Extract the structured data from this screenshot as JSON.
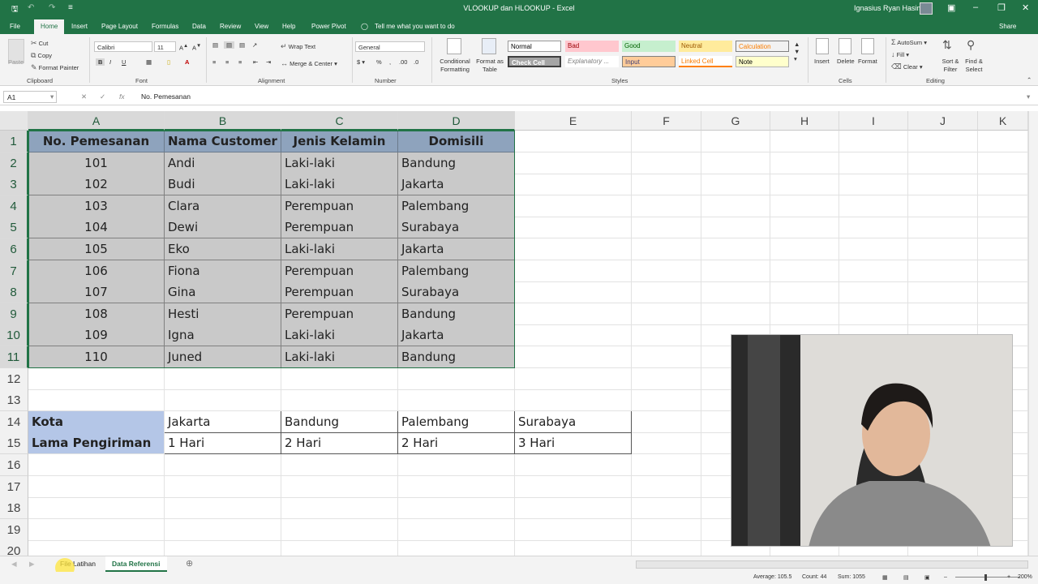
{
  "titlebar": {
    "title": "VLOOKUP dan HLOOKUP  -  Excel",
    "user": "Ignasius Ryan Hasim",
    "save_icon": "save-icon",
    "undo_icon": "undo-icon",
    "redo_icon": "redo-icon"
  },
  "tabs": [
    {
      "label": "File"
    },
    {
      "label": "Home"
    },
    {
      "label": "Insert"
    },
    {
      "label": "Page Layout"
    },
    {
      "label": "Formulas"
    },
    {
      "label": "Data"
    },
    {
      "label": "Review"
    },
    {
      "label": "View"
    },
    {
      "label": "Help"
    },
    {
      "label": "Power Pivot"
    },
    {
      "label": "Tell me what you want to do"
    }
  ],
  "share_label": "Share",
  "ribbon": {
    "clipboard": {
      "paste": "Paste",
      "cut": "Cut",
      "copy": "Copy",
      "format_painter": "Format Painter",
      "label": "Clipboard"
    },
    "font": {
      "name": "Calibri",
      "size": "11",
      "label": "Font"
    },
    "alignment": {
      "wrap": "Wrap Text",
      "merge": "Merge & Center",
      "label": "Alignment"
    },
    "number": {
      "format": "General",
      "label": "Number"
    },
    "styles": {
      "conditional": "Conditional Formatting",
      "format_table": "Format as Table",
      "cells": [
        {
          "label": "Normal",
          "bg": "#ffffff",
          "fg": "#000000"
        },
        {
          "label": "Bad",
          "bg": "#ffc7ce",
          "fg": "#9c0006"
        },
        {
          "label": "Good",
          "bg": "#c6efce",
          "fg": "#006100"
        },
        {
          "label": "Neutral",
          "bg": "#ffeb9c",
          "fg": "#9c5700"
        },
        {
          "label": "Calculation",
          "bg": "#f2f2f2",
          "fg": "#fa7d00"
        },
        {
          "label": "Check Cell",
          "bg": "#a5a5a5",
          "fg": "#ffffff"
        },
        {
          "label": "Explanatory ...",
          "bg": "#ffffff",
          "fg": "#7f7f7f"
        },
        {
          "label": "Input",
          "bg": "#ffcc99",
          "fg": "#3f3f76"
        },
        {
          "label": "Linked Cell",
          "bg": "#ffffff",
          "fg": "#fa7d00"
        },
        {
          "label": "Note",
          "bg": "#ffffcc",
          "fg": "#000000"
        }
      ],
      "label": "Styles"
    },
    "cells": {
      "insert": "Insert",
      "delete": "Delete",
      "format": "Format",
      "label": "Cells"
    },
    "editing": {
      "autosum": "AutoSum",
      "fill": "Fill",
      "clear": "Clear",
      "sort": "Sort & Filter",
      "find": "Find & Select",
      "label": "Editing"
    }
  },
  "formula_bar": {
    "name_box": "A1",
    "formula": "No. Pemesanan"
  },
  "columns": [
    "A",
    "B",
    "C",
    "D",
    "E",
    "F",
    "G",
    "H",
    "I",
    "J",
    "K"
  ],
  "rows": [
    "1",
    "2",
    "3",
    "4",
    "5",
    "6",
    "7",
    "8",
    "9",
    "10",
    "11",
    "12",
    "13",
    "14",
    "15",
    "16",
    "17",
    "18",
    "19",
    "20"
  ],
  "table": {
    "headers": [
      "No. Pemesanan",
      "Nama Customer",
      "Jenis Kelamin",
      "Domisili"
    ],
    "rows": [
      [
        "101",
        "Andi",
        "Laki-laki",
        "Bandung"
      ],
      [
        "102",
        "Budi",
        "Laki-laki",
        "Jakarta"
      ],
      [
        "103",
        "Clara",
        "Perempuan",
        "Palembang"
      ],
      [
        "104",
        "Dewi",
        "Perempuan",
        "Surabaya"
      ],
      [
        "105",
        "Eko",
        "Laki-laki",
        "Jakarta"
      ],
      [
        "106",
        "Fiona",
        "Perempuan",
        "Palembang"
      ],
      [
        "107",
        "Gina",
        "Perempuan",
        "Surabaya"
      ],
      [
        "108",
        "Hesti",
        "Perempuan",
        "Bandung"
      ],
      [
        "109",
        "Igna",
        "Laki-laki",
        "Jakarta"
      ],
      [
        "110",
        "Juned",
        "Laki-laki",
        "Bandung"
      ]
    ]
  },
  "hlookup_table": {
    "row14": [
      "Kota",
      "Jakarta",
      "Bandung",
      "Palembang",
      "Surabaya"
    ],
    "row15": [
      "Lama Pengiriman",
      "1 Hari",
      "2 Hari",
      "2 Hari",
      "3 Hari"
    ]
  },
  "sheets": [
    {
      "label": "File Latihan"
    },
    {
      "label": "Data Referensi"
    }
  ],
  "status": {
    "average": "Average: 105.5",
    "count": "Count: 44",
    "sum": "Sum: 1055",
    "zoom": "200%"
  }
}
